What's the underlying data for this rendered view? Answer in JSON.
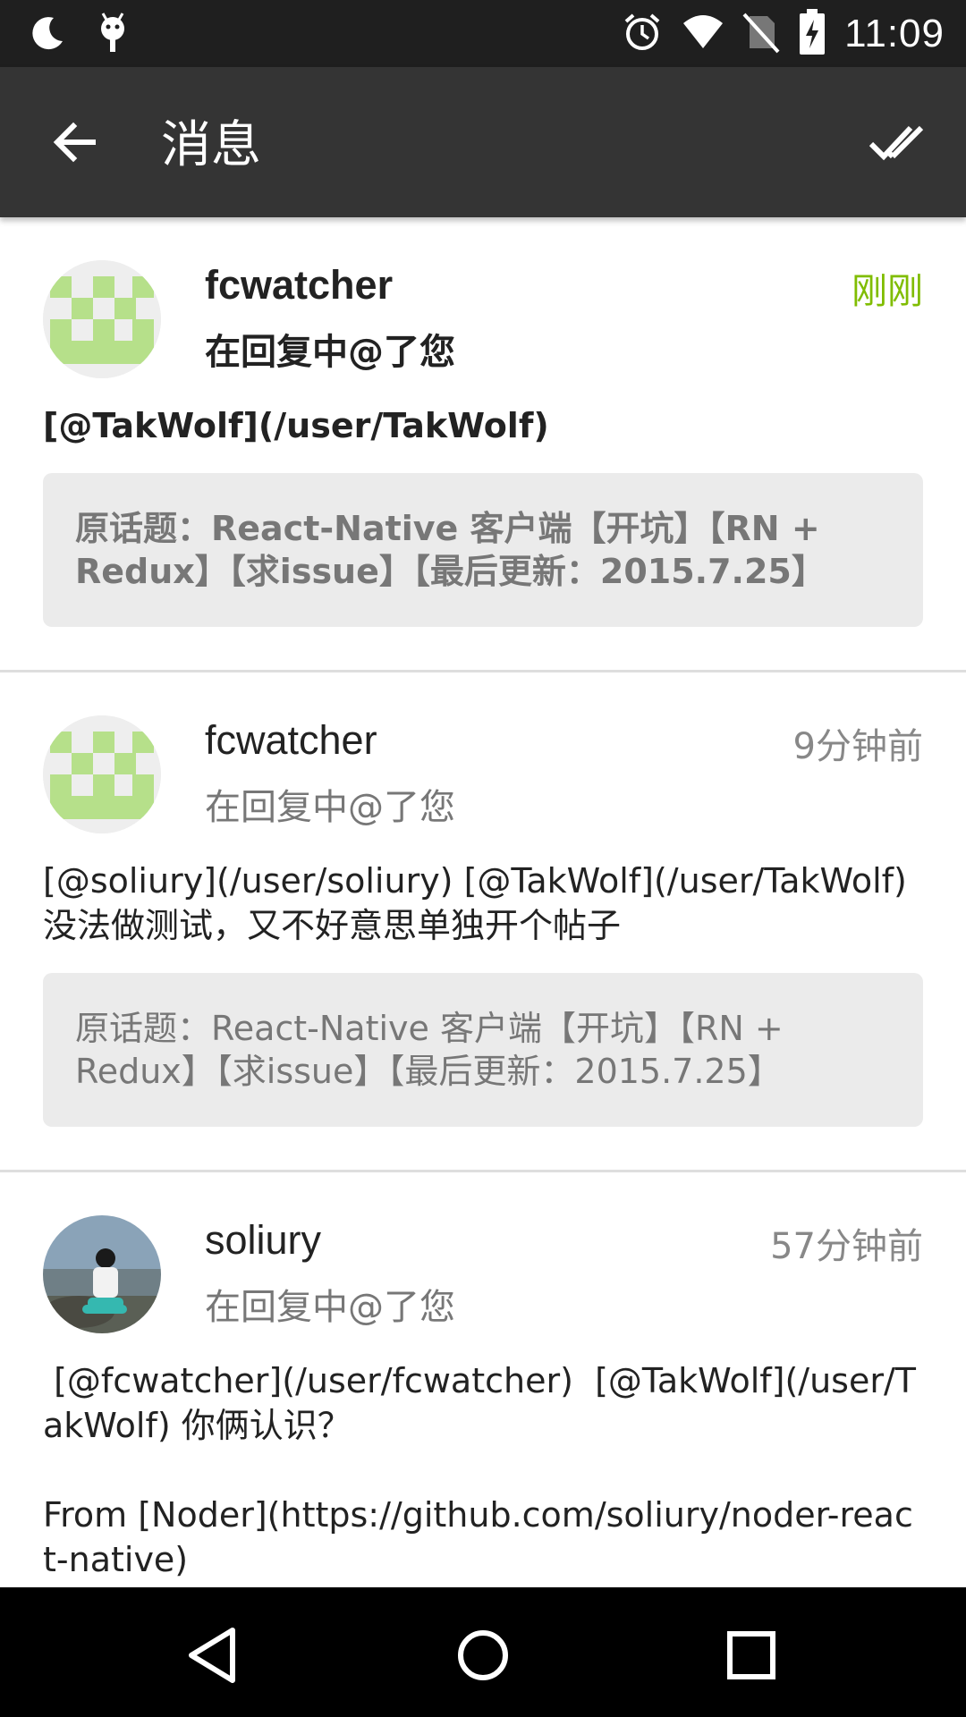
{
  "status_bar": {
    "time": "11:09",
    "left_icons": [
      "moon-icon",
      "android-debug-icon"
    ],
    "right_icons": [
      "alarm-icon",
      "wifi-icon",
      "no-sim-icon",
      "battery-charging-icon"
    ]
  },
  "app_bar": {
    "title": "消息",
    "back_icon": "arrow-left-icon",
    "action_icon": "double-check-icon"
  },
  "messages": [
    {
      "author": "fcwatcher",
      "time": "刚刚",
      "action": "在回复中@了您",
      "content": "[@TakWolf](/user/TakWolf)",
      "topic": "原话题：React-Native 客户端【开坑】【RN + Redux】【求issue】【最后更新：2015.7.25】",
      "unread": true,
      "avatar": "identicon"
    },
    {
      "author": "fcwatcher",
      "time": "9分钟前",
      "action": "在回复中@了您",
      "content": "[@soliury](/user/soliury) [@TakWolf](/user/TakWolf) 没法做测试，又不好意思单独开个帖子",
      "topic": "原话题：React-Native 客户端【开坑】【RN + Redux】【求issue】【最后更新：2015.7.25】",
      "unread": false,
      "avatar": "identicon"
    },
    {
      "author": "soliury",
      "time": "57分钟前",
      "action": "在回复中@了您",
      "content": " [@fcwatcher](/user/fcwatcher)  [@TakWolf](/user/TakWolf) 你俩认识？\n\nFrom [Noder](https://github.com/soliury/noder-react-native)",
      "topic": "",
      "unread": false,
      "avatar": "photo"
    }
  ],
  "nav_bar": {
    "icons": [
      "back-triangle-icon",
      "home-circle-icon",
      "recents-square-icon"
    ]
  },
  "colors": {
    "status_bar": "#1f1f1f",
    "app_bar": "#343434",
    "fresh_time": "#80bd01",
    "identicon": "#b6e08a",
    "topic_bg": "#ebebeb"
  }
}
